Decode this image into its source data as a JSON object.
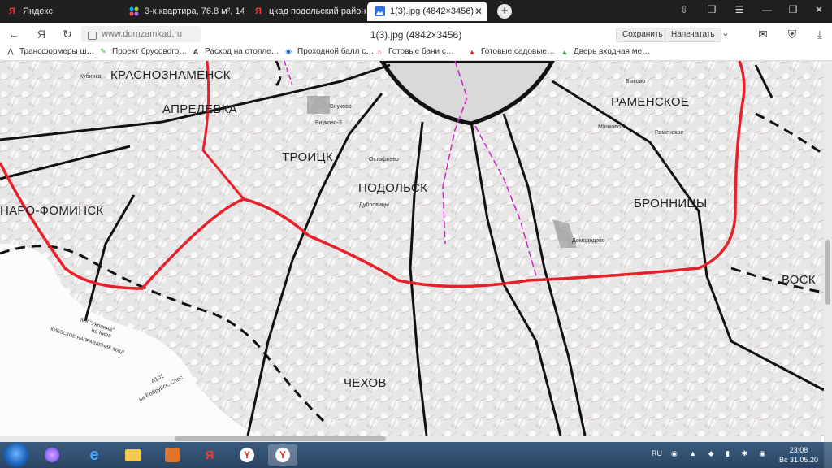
{
  "tabs": [
    {
      "label": "Яндекс",
      "icon": "yandex-icon"
    },
    {
      "label": "3-к квартира, 76.8 м², 14/…",
      "icon": "avito-icon"
    },
    {
      "label": "цкад подольский район с…",
      "icon": "yandex-icon"
    },
    {
      "label": "1(3).jpg (4842×3456)",
      "icon": "image-icon",
      "active": true
    }
  ],
  "address": {
    "url": "www.domzamkad.ru",
    "page_title": "1(3).jpg (4842×3456)",
    "save_label": "Сохранить",
    "print_label": "Напечатать"
  },
  "bookmarks": [
    {
      "label": "Трансформеры ш…",
      "icon": "transformer-icon"
    },
    {
      "label": "Проект брусового…",
      "icon": "leaf-icon"
    },
    {
      "label": "Расход на отопле…",
      "icon": "a-icon"
    },
    {
      "label": "Проходной балл с…",
      "icon": "globe-icon"
    },
    {
      "label": "Готовые бани с…",
      "icon": "house-icon"
    },
    {
      "label": "Готовые садовые…",
      "icon": "triangle-icon"
    },
    {
      "label": "Дверь входная ме…",
      "icon": "mountain-icon"
    }
  ],
  "map": {
    "cities": [
      "КРАСНОЗНАМЕНСК",
      "АПРЕЛЕВКА",
      "ТРОИЦК",
      "ПОДОЛЬСК",
      "НАРО-ФОМИНСК",
      "РАМЕНСКОЕ",
      "БРОННИЦЫ",
      "ЧЕХОВ",
      "ВОСК"
    ],
    "villages": [
      "Кубинка",
      "Внуково",
      "Внуково-3",
      "Остафьево",
      "Дубровицы",
      "Быково",
      "Мячково",
      "Раменское",
      "Домодедово"
    ],
    "road_labels": [
      "М3 \"Украина\"",
      "на Киев",
      "КИЕВСКОЕ НАПРАВЛЕНИЕ МЖД",
      "А101",
      "на Бобруйск, Спас"
    ],
    "colors": {
      "ring_road": "#e8202a",
      "highway": "#1a1a1a",
      "railway": "#000000",
      "region_border": "#d020c8"
    }
  },
  "taskbar": {
    "lang": "RU",
    "time": "23:08",
    "date": "Вс 31.05.20"
  }
}
